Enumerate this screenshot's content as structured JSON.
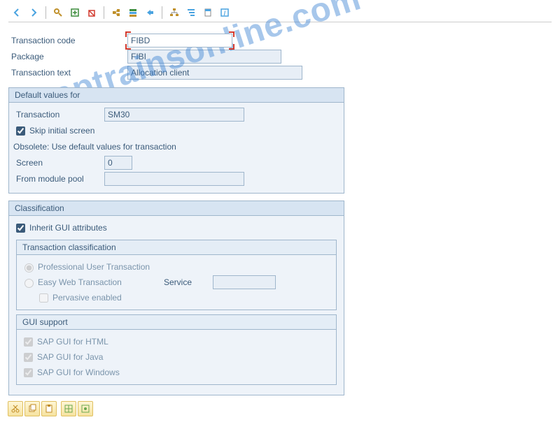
{
  "watermark": "saptrainsonline.com",
  "header": {
    "transaction_code_label": "Transaction code",
    "transaction_code_value": "FIBD",
    "package_label": "Package",
    "package_value": "FIBI",
    "transaction_text_label": "Transaction text",
    "transaction_text_value": "Allocation client"
  },
  "default_values": {
    "title": "Default values for",
    "transaction_label": "Transaction",
    "transaction_value": "SM30",
    "skip_initial_label": "Skip initial screen",
    "skip_initial_checked": true,
    "obsolete_note": "Obsolete: Use default values for transaction",
    "screen_label": "Screen",
    "screen_value": "0",
    "from_module_pool_label": "From module pool",
    "from_module_pool_value": ""
  },
  "classification": {
    "title": "Classification",
    "inherit_label": "Inherit GUI attributes",
    "inherit_checked": true,
    "trans_class_title": "Transaction classification",
    "professional_label": "Professional User Transaction",
    "easy_web_label": "Easy Web Transaction",
    "service_label": "Service",
    "service_value": "",
    "pervasive_label": "Pervasive enabled",
    "gui_support_title": "GUI support",
    "gui_html_label": "SAP GUI for HTML",
    "gui_java_label": "SAP GUI for Java",
    "gui_win_label": "SAP GUI for Windows"
  }
}
